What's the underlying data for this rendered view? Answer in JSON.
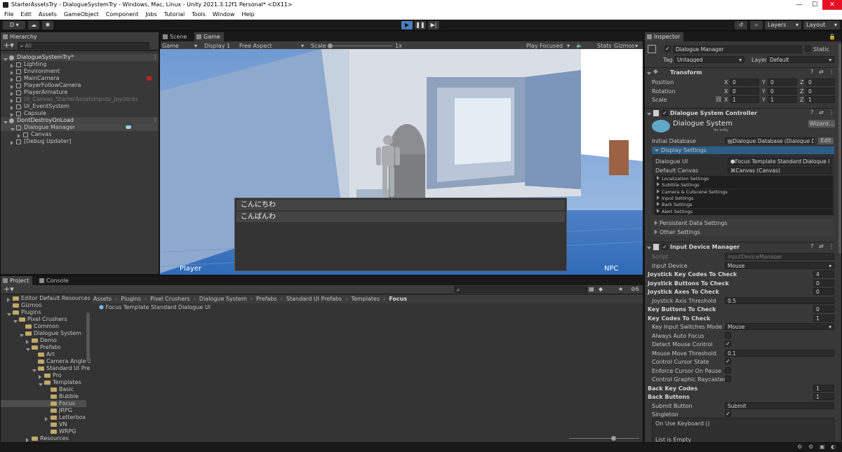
{
  "window": {
    "title": "StarterAssetsTry - DialogueSystemTry - Windows, Mac, Linux - Unity 2021.3.12f1 Personal* <DX11>",
    "controls": [
      "—",
      "☐",
      "✕"
    ]
  },
  "menu": [
    "File",
    "Edit",
    "Assets",
    "GameObject",
    "Component",
    "Jobs",
    "Tutorial",
    "Tools",
    "Window",
    "Help"
  ],
  "toolbar": {
    "account": "D",
    "layers": "Layers",
    "layout": "Layout"
  },
  "hierarchy": {
    "tab": "Hierarchy",
    "search_placeholder": "All",
    "items": [
      {
        "label": "DialogueSystemTry*",
        "depth": 0,
        "kind": "scene"
      },
      {
        "label": "Lighting",
        "depth": 1,
        "kind": "obj"
      },
      {
        "label": "Environment",
        "depth": 1,
        "kind": "obj"
      },
      {
        "label": "MainCamera",
        "depth": 1,
        "kind": "obj"
      },
      {
        "label": "PlayerFollowCamera",
        "depth": 1,
        "kind": "obj"
      },
      {
        "label": "PlayerArmature",
        "depth": 1,
        "kind": "obj"
      },
      {
        "label": "UI_Canvas_StarterAssetsInputs_Joysticks",
        "depth": 1,
        "kind": "obj"
      },
      {
        "label": "UI_EventSystem",
        "depth": 1,
        "kind": "obj"
      },
      {
        "label": "Capsule",
        "depth": 1,
        "kind": "obj"
      },
      {
        "label": "DontDestroyOnLoad",
        "depth": 0,
        "kind": "scene"
      },
      {
        "label": "Dialogue Manager",
        "depth": 1,
        "kind": "obj"
      },
      {
        "label": "Canvas",
        "depth": 2,
        "kind": "obj"
      },
      {
        "label": "[Debug Updater]",
        "depth": 1,
        "kind": "obj"
      }
    ]
  },
  "sceneview": {
    "tabs": [
      "Scene",
      "Game"
    ],
    "game_dropdown": "Game",
    "display": "Display 1",
    "aspect": "Free Aspect",
    "scale_label": "Scale",
    "scale_value": "1x",
    "play_focused": "Play Focused",
    "stats": "Stats",
    "gizmos": "Gizmos",
    "dialogue_lines": [
      "こんにちわ",
      "こんばんわ"
    ],
    "player_label": "Player",
    "npc_label": "NPC"
  },
  "project": {
    "tabs": [
      "Project",
      "Console"
    ],
    "tree": [
      {
        "label": "Editor Default Resources",
        "depth": 1
      },
      {
        "label": "Gizmos",
        "depth": 1
      },
      {
        "label": "Plugins",
        "depth": 1
      },
      {
        "label": "Pixel Crushers",
        "depth": 2
      },
      {
        "label": "Common",
        "depth": 3
      },
      {
        "label": "Dialogue System",
        "depth": 3
      },
      {
        "label": "Demo",
        "depth": 4
      },
      {
        "label": "Prefabs",
        "depth": 4
      },
      {
        "label": "Art",
        "depth": 5
      },
      {
        "label": "Camera Angle S",
        "depth": 5
      },
      {
        "label": "Standard UI Pre",
        "depth": 5
      },
      {
        "label": "Pro",
        "depth": 6
      },
      {
        "label": "Templates",
        "depth": 6
      },
      {
        "label": "Basic",
        "depth": 7
      },
      {
        "label": "Bubble",
        "depth": 7
      },
      {
        "label": "Focus",
        "depth": 7
      },
      {
        "label": "JRPG",
        "depth": 7
      },
      {
        "label": "Letterbox",
        "depth": 7
      },
      {
        "label": "VN",
        "depth": 7
      },
      {
        "label": "WRPG",
        "depth": 7
      },
      {
        "label": "Resources",
        "depth": 4
      }
    ],
    "breadcrumb": [
      "Assets",
      "Plugins",
      "Pixel Crushers",
      "Dialogue System",
      "Prefabs",
      "Standard UI Prefabs",
      "Templates",
      "Focus"
    ],
    "asset": "Focus Template Standard Dialogue UI",
    "badge_count": "6"
  },
  "inspector": {
    "tab": "Inspector",
    "object_name": "Dialogue Manager",
    "static_label": "Static",
    "tag_label": "Tag",
    "tag_value": "Untagged",
    "layer_label": "Layer",
    "layer_value": "Default",
    "transform": {
      "title": "Transform",
      "rows": [
        {
          "label": "Position",
          "x": "0",
          "y": "0",
          "z": "0"
        },
        {
          "label": "Rotation",
          "x": "0",
          "y": "0",
          "z": "0"
        },
        {
          "label": "Scale",
          "x": "1",
          "y": "1",
          "z": "1"
        }
      ]
    },
    "dsc": {
      "title": "Dialogue System Controller",
      "logo": "Dialogue System",
      "logo_sub": "for unity",
      "wizard": "Wizard...",
      "initial_db_label": "Initial Database",
      "initial_db_value": "Dialogue Database (Dialogue D",
      "edit": "Edit",
      "display_settings": "Display Settings",
      "dialogue_ui_label": "Dialogue UI",
      "dialogue_ui_value": "Focus Template Standard Dialogue I",
      "default_canvas_label": "Default Canvas",
      "default_canvas_value": "Canvas (Canvas)",
      "sub_settings": [
        "Localization Settings",
        "Subtitle Settings",
        "Camera & Cutscene Settings",
        "Input Settings",
        "Bark Settings",
        "Alert Settings"
      ],
      "persistent": "Persistent Data Settings",
      "other": "Other Settings"
    },
    "idm": {
      "title": "Input Device Manager",
      "script_label": "Script",
      "script_value": "InputDeviceManager",
      "input_device_label": "Input Device",
      "input_device_value": "Mouse",
      "joystick_key_codes": "Joystick Key Codes To Check",
      "joystick_key_codes_val": "4",
      "joystick_buttons": "Joystick Buttons To Check",
      "joystick_buttons_val": "0",
      "joystick_axes": "Joystick Axes To Check",
      "joystick_axes_val": "0",
      "joystick_axis_threshold": "Joystick Axis Threshold",
      "joystick_axis_threshold_val": "0.5",
      "key_buttons": "Key Buttons To Check",
      "key_buttons_val": "0",
      "key_codes": "Key Codes To Check",
      "key_codes_val": "1",
      "key_input_switches": "Key Input Switches Mode To",
      "key_input_switches_val": "Mouse",
      "always_auto_focus": "Always Auto Focus",
      "detect_mouse_control": "Detect Mouse Control",
      "mouse_move_threshold": "Mouse Move Threshold",
      "mouse_move_threshold_val": "0.1",
      "control_cursor_state": "Control Cursor State",
      "enforce_cursor": "Enforce Cursor On Pause",
      "control_graphic": "Control Graphic Raycasters",
      "back_key_codes": "Back Key Codes",
      "back_key_codes_val": "1",
      "back_buttons": "Back Buttons",
      "back_buttons_val": "1",
      "submit_button": "Submit Button",
      "submit_button_val": "Submit",
      "singleton": "Singleton",
      "on_use_keyboard": "On Use Keyboard ()",
      "list_empty": "List is Empty"
    }
  },
  "colors": {
    "accent": "#3a79bb",
    "play_active": "#4a7fbf",
    "selection": "#2c5d87"
  }
}
